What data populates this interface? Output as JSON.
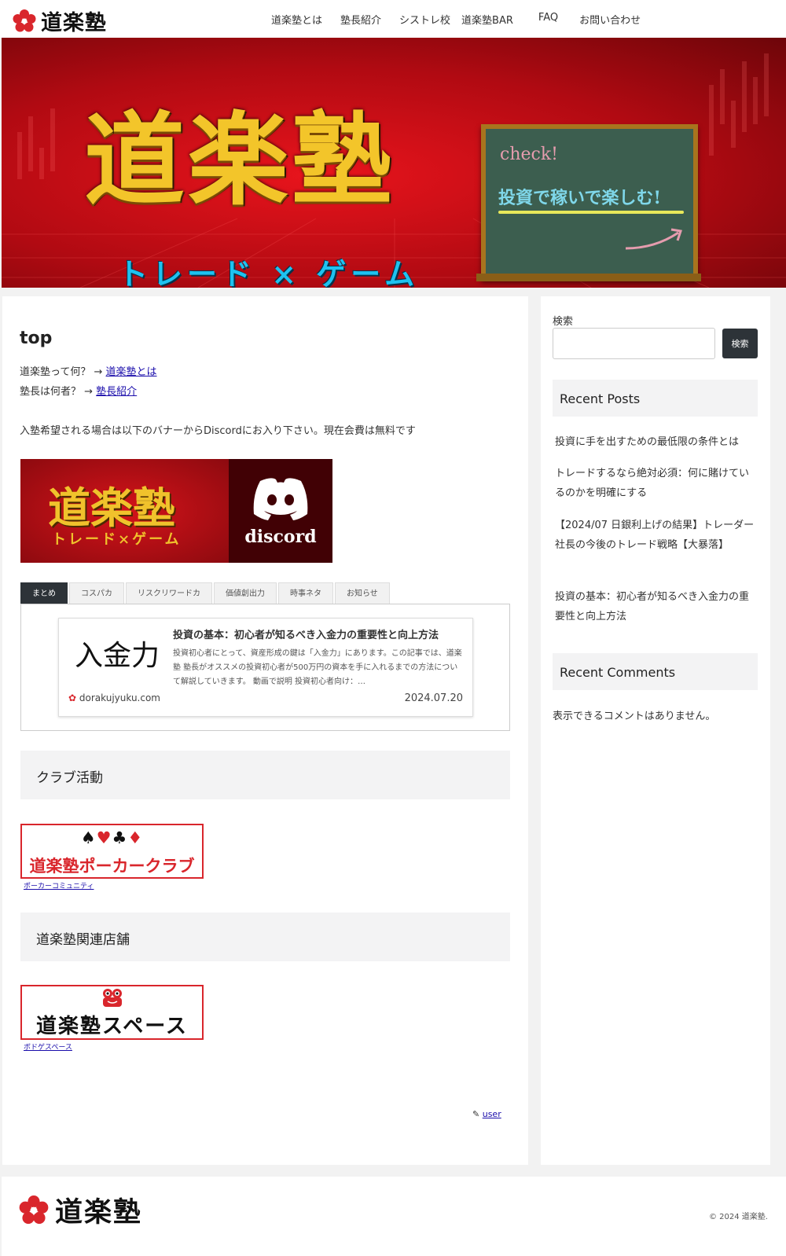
{
  "header": {
    "site_name": "道楽塾",
    "nav": [
      "道楽塾とは",
      "塾長紹介",
      "シストレ校",
      "道楽塾BAR",
      "FAQ",
      "お問い合わせ"
    ]
  },
  "hero": {
    "title": "道楽塾",
    "subtitle": "トレード × ゲーム",
    "board_check": "check!",
    "board_message": "投資で稼いで楽しむ!"
  },
  "main": {
    "title": "top",
    "intro_q1": "道楽塾って何？ → ",
    "intro_link1": "道楽塾とは",
    "intro_q2": "塾長は何者？ → ",
    "intro_link2": "塾長紹介",
    "join_text": "入塾希望される場合は以下のバナーからDiscordにお入り下さい。現在会費は無料です",
    "discord_banner": {
      "title": "道楽塾",
      "subtitle": "トレード×ゲーム",
      "label": "discord"
    },
    "tabs": [
      "まとめ",
      "コスパカ",
      "リスクリワードカ",
      "価値創出力",
      "時事ネタ",
      "お知らせ"
    ],
    "card": {
      "thumb_text": "入金力",
      "title": "投資の基本：初心者が知るべき入金力の重要性と向上方法",
      "description": "投資初心者にとって、資産形成の鍵は「入金力」にあります。この記事では、道楽塾 塾長がオススメの投資初心者が500万円の資本を手に入れるまでの方法について解説していきます。 動画で説明 投資初心者向け：…",
      "domain": "dorakujyuku.com",
      "date": "2024.07.20"
    },
    "club_heading": "クラブ活動",
    "club_banner": {
      "suits": "♠♥♣♦",
      "name": "道楽塾ポーカークラブ"
    },
    "club_link": "ポーカーコミュニティ",
    "store_heading": "道楽塾関連店舗",
    "space_banner_name": "道楽塾スペース",
    "space_link": "ボドゲスペース",
    "author": "user"
  },
  "sidebar": {
    "search_label": "検索",
    "search_button": "検索",
    "recent_posts_heading": "Recent Posts",
    "recent_posts": [
      "投資に手を出すための最低限の条件とは",
      "トレードするなら絶対必須：何に賭けているのかを明確にする",
      "【2024/07 日銀利上げの結果】トレーダー社長の今後のトレード戦略【大暴落】",
      "投資の基本：初心者が知るべき入金力の重要性と向上方法"
    ],
    "recent_comments_heading": "Recent Comments",
    "no_comments": "表示できるコメントはありません。"
  },
  "footer": {
    "site_name": "道楽塾",
    "copyright": "© 2024 道楽塾."
  },
  "colors": {
    "brand_red": "#d9262c",
    "hero_gold": "#f3c52a",
    "hero_cyan": "#1ec2f0",
    "dark_button": "#2d3338",
    "link": "#1a0dab"
  }
}
